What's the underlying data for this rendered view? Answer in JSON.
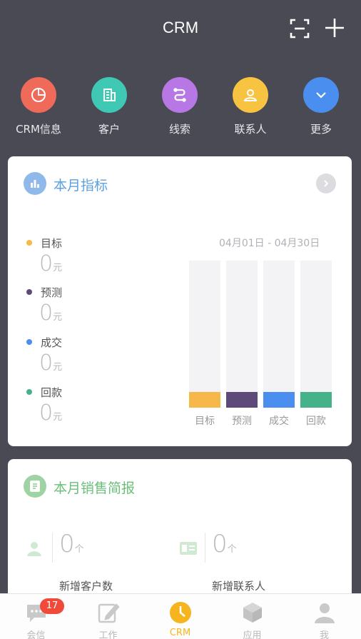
{
  "app_title": "CRM",
  "quick_actions": [
    {
      "label": "CRM信息",
      "icon": "pie-chart-icon",
      "color": "#f06a5a"
    },
    {
      "label": "客户",
      "icon": "building-icon",
      "color": "#3fc9b4"
    },
    {
      "label": "线索",
      "icon": "route-icon",
      "color": "#b778e6"
    },
    {
      "label": "联系人",
      "icon": "person-icon",
      "color": "#f7c340"
    },
    {
      "label": "更多",
      "icon": "chevron-down-icon",
      "color": "#4a8ff0"
    }
  ],
  "monthly": {
    "title": "本月指标",
    "date_range": "04月01日 - 04月30日",
    "metrics": [
      {
        "name": "目标",
        "value": "0",
        "unit": "元",
        "color": "#f7b84a"
      },
      {
        "name": "预测",
        "value": "0",
        "unit": "元",
        "color": "#5e4a78"
      },
      {
        "name": "成交",
        "value": "0",
        "unit": "元",
        "color": "#4a8ff0"
      },
      {
        "name": "回款",
        "value": "0",
        "unit": "元",
        "color": "#45b28a"
      }
    ],
    "bar_labels": [
      "目标",
      "预测",
      "成交",
      "回款"
    ]
  },
  "sales_report": {
    "title": "本月销售简报",
    "new_customers": {
      "value": "0",
      "unit": "个",
      "label": "新增客户数"
    },
    "new_contacts": {
      "value": "0",
      "unit": "个",
      "label": "新增联系人"
    }
  },
  "tabs": [
    {
      "label": "会信",
      "icon": "chat-icon",
      "badge": "17"
    },
    {
      "label": "工作",
      "icon": "edit-icon"
    },
    {
      "label": "CRM",
      "icon": "clock-icon",
      "active": true
    },
    {
      "label": "应用",
      "icon": "cube-icon"
    },
    {
      "label": "我",
      "icon": "user-icon"
    }
  ],
  "colors": {
    "accent": "#f6b51e",
    "header_bg": "#4a4a54",
    "card1_title": "#5b9fe0",
    "card2_title": "#6cbf7a"
  }
}
